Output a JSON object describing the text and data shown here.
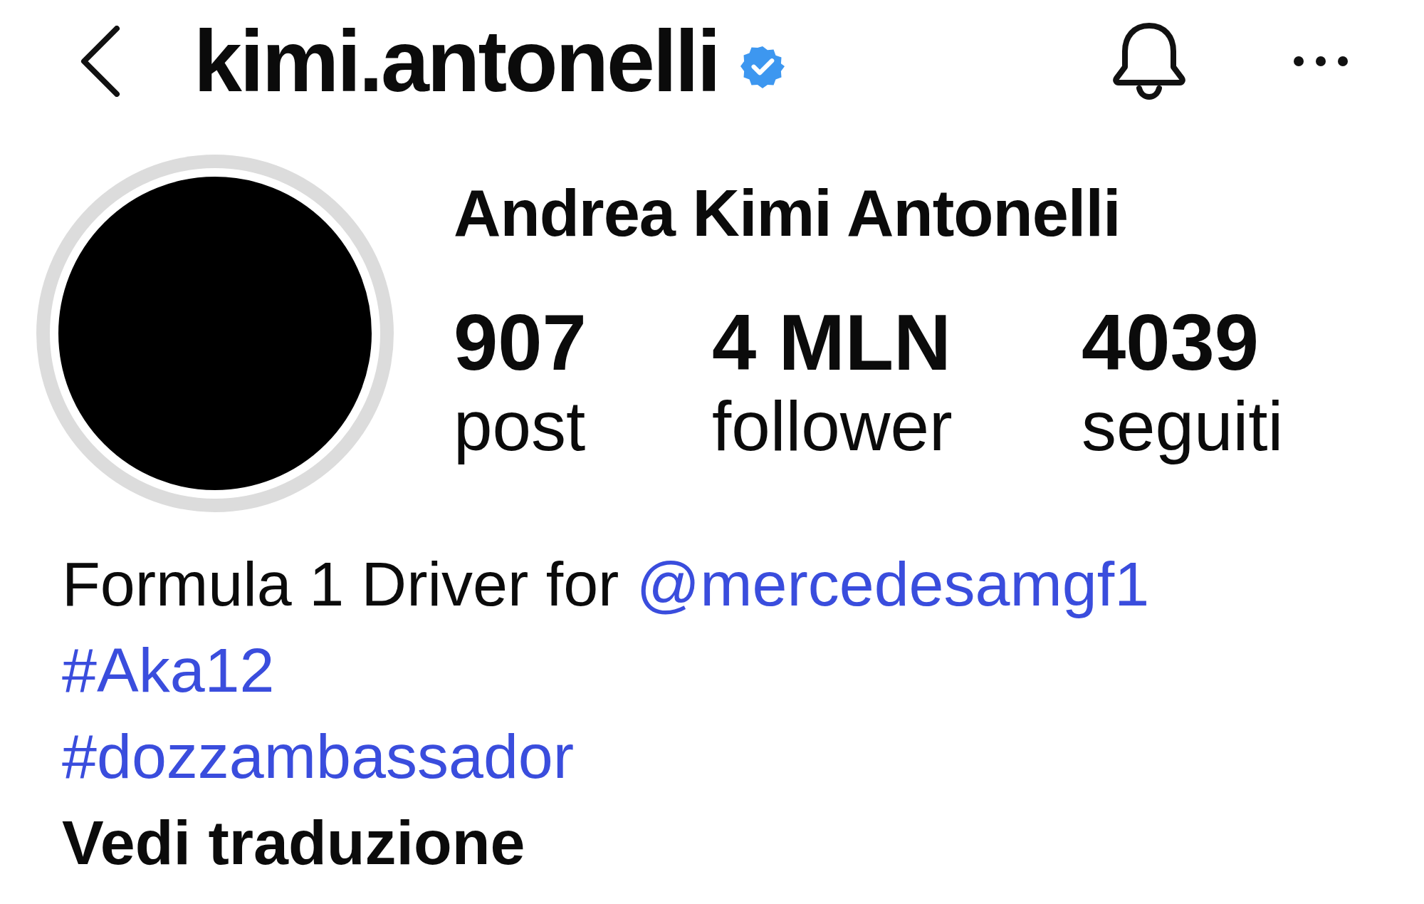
{
  "header": {
    "username": "kimi.antonelli",
    "verified": true
  },
  "profile": {
    "name": "Andrea Kimi Antonelli",
    "stats": [
      {
        "value": "907",
        "label": "post"
      },
      {
        "value": "4 MLN",
        "label": "follower"
      },
      {
        "value": "4039",
        "label": "seguiti"
      }
    ]
  },
  "bio": {
    "lines": [
      {
        "kind": "sentence",
        "text": "Formula 1 Driver for ",
        "link": "@mercedesamgf1"
      },
      {
        "kind": "hashtag",
        "text": "#Aka12"
      },
      {
        "kind": "hashtag",
        "text": "#dozzambassador"
      },
      {
        "kind": "translate",
        "text": "Vedi traduzione"
      }
    ]
  }
}
